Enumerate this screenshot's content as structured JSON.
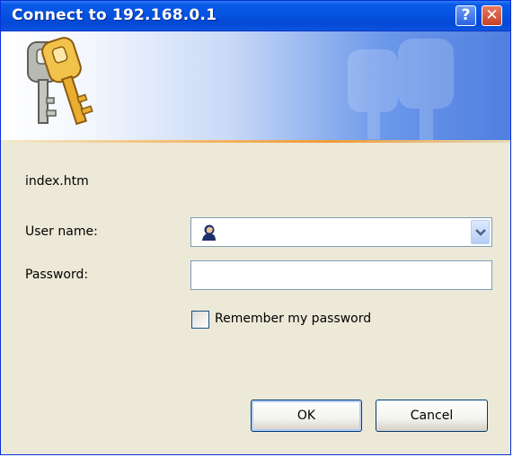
{
  "window": {
    "title": "Connect to 192.168.0.1"
  },
  "titlebar_buttons": {
    "help": "?",
    "close": "✕"
  },
  "realm": "index.htm",
  "form": {
    "username_label": "User name:",
    "username_value": "",
    "password_label": "Password:",
    "password_value": "",
    "remember_label": "Remember my password",
    "remember_checked": false
  },
  "buttons": {
    "ok": "OK",
    "cancel": "Cancel"
  },
  "icons": {
    "banner": "keys-icon",
    "user": "user-icon",
    "dropdown": "chevron-down-icon"
  },
  "colors": {
    "titlebar": "#0553e2",
    "dialog_bg": "#ece9d8",
    "close_button": "#c7412a",
    "input_border": "#7f9db9"
  }
}
